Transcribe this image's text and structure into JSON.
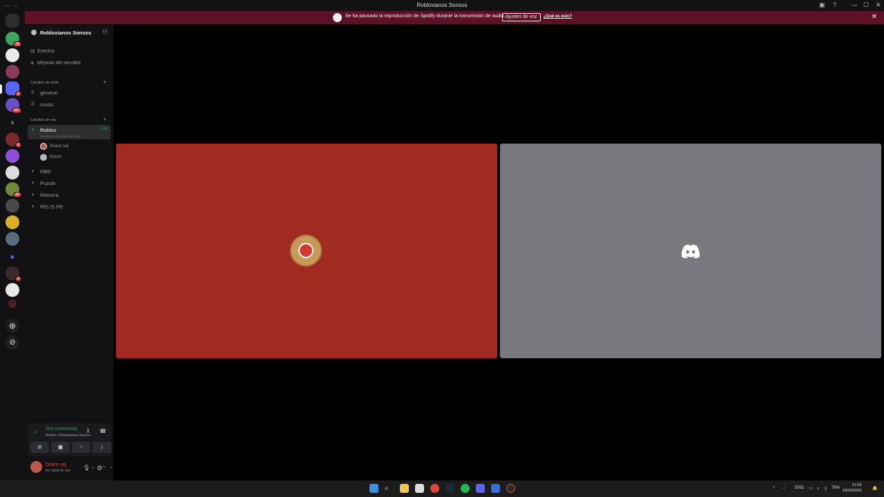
{
  "window": {
    "title": "Robloxianos Sonsos",
    "back_glyph": "←  →",
    "minimize": "—",
    "maximize": "☐",
    "close": "✕"
  },
  "banner": {
    "message": "Se ha pausado la reproducción de Spotify durante la transmisión de audio.",
    "button_label": "Ajustes de voz",
    "link_label": "¿Qué es esto?",
    "close": "✕"
  },
  "server_rail": {
    "badges": [
      "39",
      "2",
      "167",
      "9",
      "69",
      "3"
    ]
  },
  "sidebar": {
    "server_name": "Robloxianos Sonsos",
    "chevron": "⌄",
    "top_items": [
      {
        "icon": "calendar-icon",
        "label": "Eventos"
      },
      {
        "icon": "boost-icon",
        "label": "Mejoras del servidor"
      }
    ],
    "text_category": "Canales de texto",
    "text_channels": [
      "general",
      "music"
    ],
    "voice_category": "Canales de voz",
    "active_voice": {
      "label": "Roblox",
      "timer": "0:38",
      "status": "Establece un estado de canal"
    },
    "voice_users": [
      "Draco sej",
      "Pricht"
    ],
    "voice_channels": [
      "DBD",
      "Puzzle",
      "Maincra",
      "PELIS PE"
    ]
  },
  "voice_panel": {
    "title": "Voz conectada",
    "subtitle": "Roblox / Robloxianos Sonsos"
  },
  "user_panel": {
    "name": "Draco sej",
    "status": "En canal de voz"
  },
  "taskbar": {
    "lang": "ENG",
    "battery": "76%",
    "time": "21:55",
    "date": "18/03/2026"
  },
  "colors": {
    "accent_green": "#23a55a",
    "banner_bg": "#5c1224",
    "tile_red": "#a12a22",
    "tile_grey": "#77797f"
  }
}
